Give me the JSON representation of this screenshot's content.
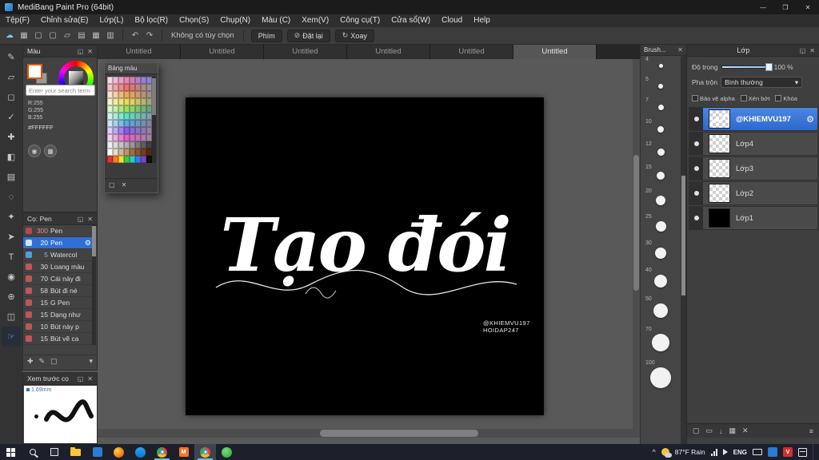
{
  "icons": {
    "min": "—",
    "max": "❐",
    "close": "✕",
    "popout": "◱",
    "undo": "↶",
    "redo": "↷",
    "rotate": "↻",
    "slash": "⊘",
    "dropdown": "▾",
    "gear": "⚙",
    "check": "✓",
    "chevron_up": "^",
    "page": "▢",
    "folder": "▭",
    "down": "↓",
    "grid": "▦",
    "dot": "◉",
    "plus": "✚",
    "pen": "✎",
    "menu": "≡",
    "delete": "✕"
  },
  "titlebar": {
    "title": "MediBang Paint Pro (64bit)"
  },
  "menu": {
    "items": [
      "Tệp(F)",
      "Chỉnh sửa(E)",
      "Lớp(L)",
      "Bộ lọc(R)",
      "Chọn(S)",
      "Chụp(N)",
      "Màu (C)",
      "Xem(V)",
      "Công cụ(T)",
      "Cửa sổ(W)",
      "Cloud",
      "Help"
    ]
  },
  "toolbar": {
    "icons": [
      "cloud-upload-icon",
      "save-icon",
      "chat-icon",
      "comment-icon",
      "new-page-icon",
      "export-icon",
      "grid-icon",
      "table-icon"
    ],
    "icon_glyphs": [
      "☁",
      "▦",
      "▢",
      "▢",
      "▱",
      "▤",
      "▦",
      "▥"
    ],
    "no_option": "Không có tùy chọn",
    "btn_phim": "Phím",
    "btn_reset": "Đặt lại",
    "btn_rotate": "Xoay"
  },
  "tabs": {
    "items": [
      "Untitled",
      "Untitled",
      "Untitled",
      "Untitled",
      "Untitled",
      "Untitled"
    ],
    "active_index": 5
  },
  "tools": [
    "pen-tool",
    "eraser-tool",
    "select-tool",
    "snap-tool",
    "move-tool",
    "bucket-tool",
    "gradient-tool",
    "lasso-tool",
    "wand-tool",
    "pointer-tool",
    "text-tool",
    "eyedropper-tool",
    "zoom-tool",
    "divide-tool",
    "hand-tool"
  ],
  "active_tool": "hand-tool",
  "color_panel": {
    "title": "Màu",
    "search_placeholder": "Enter your search term",
    "rgb": [
      "R:255",
      "G:255",
      "B:255"
    ],
    "hex": "#FFFFFF"
  },
  "palette_window": {
    "title": "Bảng màu",
    "colors": [
      "#f6d7e6",
      "#f2b9d3",
      "#eda0c4",
      "#e788b5",
      "#d37fb4",
      "#bb7fc0",
      "#9e7fca",
      "#8a82d2",
      "#f3c4c4",
      "#efa4a4",
      "#ec8a8a",
      "#e87272",
      "#d97a7a",
      "#c48484",
      "#ad8c8c",
      "#999090",
      "#f6e3cf",
      "#f1cfa6",
      "#edbc82",
      "#e9a95e",
      "#dda468",
      "#cb9d70",
      "#b69678",
      "#a39080",
      "#f7f2cf",
      "#f2e9a6",
      "#eee082",
      "#ead75e",
      "#ddd068",
      "#cbc270",
      "#b6b478",
      "#a3a680",
      "#e2f3d0",
      "#c9ecaa",
      "#b1e585",
      "#99de60",
      "#8fd26b",
      "#83c273",
      "#77b07b",
      "#6ba083",
      "#d0f3ea",
      "#aaecdc",
      "#85e5cf",
      "#60dec1",
      "#6bd2bd",
      "#73c2b8",
      "#7bb0b2",
      "#83a0ac",
      "#d0e4f3",
      "#aacfec",
      "#85bbe5",
      "#60a6de",
      "#6b9ed2",
      "#7396c2",
      "#7b8eb0",
      "#8386a0",
      "#dcd0f3",
      "#c0aaec",
      "#a485e5",
      "#8860de",
      "#8a6bd2",
      "#8d73c2",
      "#8f7bb0",
      "#9283a0",
      "#f3d0ec",
      "#ecaade",
      "#e585d0",
      "#de60c2",
      "#d26bbc",
      "#c273b4",
      "#b07bac",
      "#a083a4",
      "#efefef",
      "#d9d9d9",
      "#c3c3c3",
      "#adadad",
      "#969696",
      "#7a7a7a",
      "#5e5e5e",
      "#424242",
      "#ffffff",
      "#e8dcc8",
      "#d0b89a",
      "#b8946c",
      "#a07040",
      "#885830",
      "#704020",
      "#582810",
      "#e83030",
      "#f08030",
      "#f0e030",
      "#40c840",
      "#30c8c8",
      "#3080e8",
      "#8040d0",
      "#101010"
    ]
  },
  "brush_panel": {
    "title": "Cọ: Pen",
    "brushes": [
      {
        "size": "300",
        "name": "Pen",
        "chip": "#b94a4a",
        "num_color": "#e08a8a"
      },
      {
        "size": "20",
        "name": "Pen",
        "chip": "#cfe2ff",
        "selected": true
      },
      {
        "size": "5",
        "name": "Watercol",
        "chip": "#5a9ae0",
        "num_color": "#7fb2ff"
      },
      {
        "size": "30",
        "name": "Loang màu",
        "chip": "#c05656"
      },
      {
        "size": "70",
        "name": "Cái này đi",
        "chip": "#c05656"
      },
      {
        "size": "58",
        "name": "Bút đi né",
        "chip": "#c05656"
      },
      {
        "size": "15",
        "name": "G Pen",
        "chip": "#c05656"
      },
      {
        "size": "15",
        "name": "Dạng như",
        "chip": "#c05656"
      },
      {
        "size": "10",
        "name": "Bút này p",
        "chip": "#c05656"
      },
      {
        "size": "15",
        "name": "Bút vẽ ca",
        "chip": "#c05656"
      }
    ]
  },
  "preview_panel": {
    "title": "Xem trước cọ",
    "size": "1.69mm"
  },
  "canvas": {
    "text": "Tạo đói",
    "watermark_line1": "@KHIEMVU197",
    "watermark_line2": "HOIDAP247"
  },
  "size_panel": {
    "title": "Brush...",
    "sizes": [
      4,
      5,
      7,
      10,
      12,
      15,
      20,
      25,
      30,
      40,
      50,
      70,
      100
    ]
  },
  "layers_panel": {
    "title": "Lớp",
    "opacity_label": "Độ trong",
    "opacity_value": "100 %",
    "blend_label": "Pha trộn",
    "blend_value": "Bình thường",
    "checkboxes": [
      "Bảo vệ alpha",
      "Xén bớt",
      "Khóa"
    ],
    "layers": [
      {
        "name": "@KHIEMVU197",
        "thumb": "checker-stroke",
        "selected": true
      },
      {
        "name": "Lớp4",
        "thumb": "checker"
      },
      {
        "name": "Lớp3",
        "thumb": "checker"
      },
      {
        "name": "Lớp2",
        "thumb": "checker"
      },
      {
        "name": "Lớp1",
        "thumb": "black"
      }
    ]
  },
  "taskbar": {
    "apps": [
      {
        "name": "file-explorer-icon"
      },
      {
        "name": "photos-icon"
      },
      {
        "name": "firefox-icon"
      },
      {
        "name": "messenger-icon"
      },
      {
        "name": "chrome-icon",
        "open": true
      },
      {
        "name": "medibang-icon"
      },
      {
        "name": "chrome-icon-2",
        "active": true
      },
      {
        "name": "coccoc-icon"
      }
    ],
    "weather": "87°F Rain",
    "language": "ENG",
    "v_badge": "V"
  }
}
